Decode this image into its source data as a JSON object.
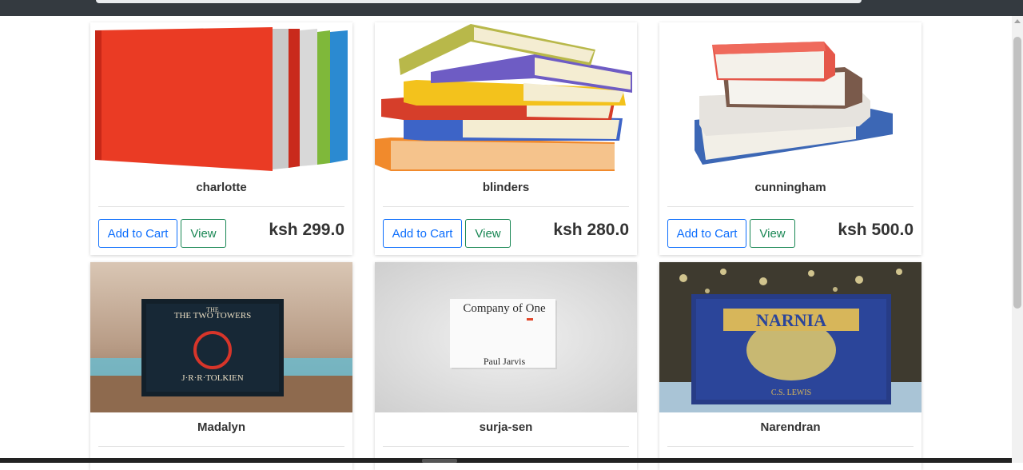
{
  "products": [
    {
      "name": "charlotte",
      "price": "ksh 299.0",
      "add_label": "Add to Cart",
      "view_label": "View",
      "image": "red-hardcover-stack"
    },
    {
      "name": "blinders",
      "price": "ksh 280.0",
      "add_label": "Add to Cart",
      "view_label": "View",
      "image": "colorful-book-pile"
    },
    {
      "name": "cunningham",
      "price": "ksh 500.0",
      "add_label": "Add to Cart",
      "view_label": "View",
      "image": "vintage-book-stack"
    },
    {
      "name": "Madalyn",
      "image": "two-towers-cover",
      "cover_title": "THE TWO TOWERS",
      "cover_author": "J·R·R·TOLKIEN"
    },
    {
      "name": "surja-sen",
      "image": "company-of-one-cover",
      "cover_title": "Company of One",
      "cover_author": "Paul Jarvis"
    },
    {
      "name": "Narendran",
      "image": "narnia-cover",
      "cover_title": "NARNIA",
      "cover_author": "C.S. LEWIS"
    }
  ],
  "colors": {
    "primary": "#0d6efd",
    "success": "#198754",
    "navbar": "#343a40"
  }
}
